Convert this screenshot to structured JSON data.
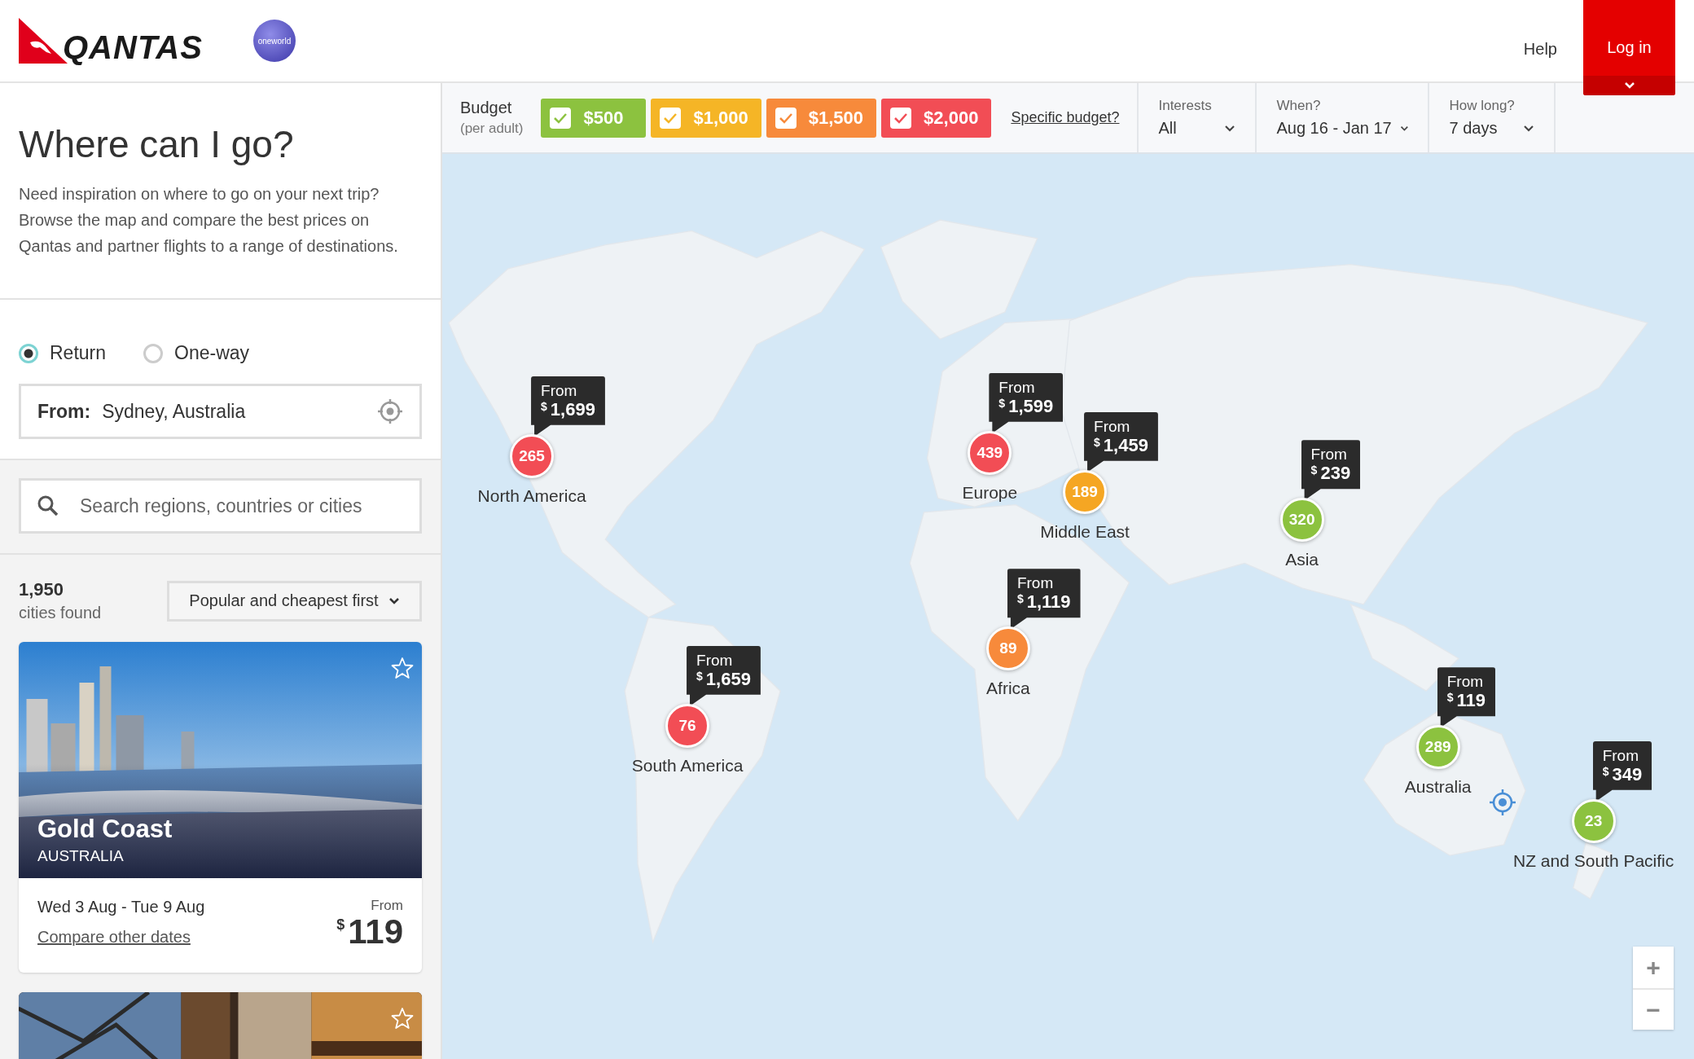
{
  "header": {
    "logo_text": "QANTAS",
    "alliance_badge": "oneworld",
    "nav": [
      {
        "label": "Help"
      }
    ],
    "login": "Log in"
  },
  "intro": {
    "title": "Where can I go?",
    "description": "Need inspiration on where to go on your next trip? Browse the map and compare the best prices on Qantas and partner flights to a range of destinations."
  },
  "trip_types": [
    {
      "label": "Return",
      "selected": true
    },
    {
      "label": "One-way",
      "selected": false
    }
  ],
  "from": {
    "label": "From:",
    "value": "Sydney, Australia"
  },
  "search": {
    "placeholder": "Search regions, countries or cities"
  },
  "results": {
    "count": "1,950",
    "caption": "cities found",
    "sort": "Popular and cheapest first"
  },
  "cards": [
    {
      "city": "Gold Coast",
      "country": "AUSTRALIA",
      "dates": "Wed 3 Aug - Tue 9 Aug",
      "link": "Compare other dates",
      "price_label": "From",
      "currency": "$",
      "price": "119",
      "favorite": false
    },
    {
      "favorite": false
    }
  ],
  "filters": {
    "budget_label": "Budget",
    "budget_note": "(per adult)",
    "budgets": [
      {
        "label": "$500",
        "checked": true,
        "color": "#8cc23f"
      },
      {
        "label": "$1,000",
        "checked": true,
        "color": "#f5b526"
      },
      {
        "label": "$1,500",
        "checked": true,
        "color": "#f78a3b"
      },
      {
        "label": "$2,000",
        "checked": true,
        "color": "#f24d55"
      }
    ],
    "specific_link": "Specific budget?",
    "dropdowns": [
      {
        "label": "Interests",
        "value": "All"
      },
      {
        "label": "When?",
        "value": "Aug 16 - Jan 17"
      },
      {
        "label": "How long?",
        "value": "7 days"
      }
    ]
  },
  "map": {
    "regions": [
      {
        "name": "North America",
        "count": "265",
        "price_label": "From",
        "currency": "$",
        "price": "1,699",
        "color": "#f24d55"
      },
      {
        "name": "Europe",
        "count": "439",
        "price_label": "From",
        "currency": "$",
        "price": "1,599",
        "color": "#f24d55"
      },
      {
        "name": "Middle East",
        "count": "189",
        "price_label": "From",
        "currency": "$",
        "price": "1,459",
        "color": "#f5a623"
      },
      {
        "name": "Asia",
        "count": "320",
        "price_label": "From",
        "currency": "$",
        "price": "239",
        "color": "#8cc23f"
      },
      {
        "name": "Africa",
        "count": "89",
        "price_label": "From",
        "currency": "$",
        "price": "1,119",
        "color": "#f78a3b"
      },
      {
        "name": "South America",
        "count": "76",
        "price_label": "From",
        "currency": "$",
        "price": "1,659",
        "color": "#f24d55"
      },
      {
        "name": "Australia",
        "count": "289",
        "price_label": "From",
        "currency": "$",
        "price": "119",
        "color": "#8cc23f"
      },
      {
        "name": "NZ and South Pacific",
        "count": "23",
        "price_label": "From",
        "currency": "$",
        "price": "349",
        "color": "#8cc23f"
      }
    ],
    "zoom": [
      "+",
      "−"
    ]
  }
}
